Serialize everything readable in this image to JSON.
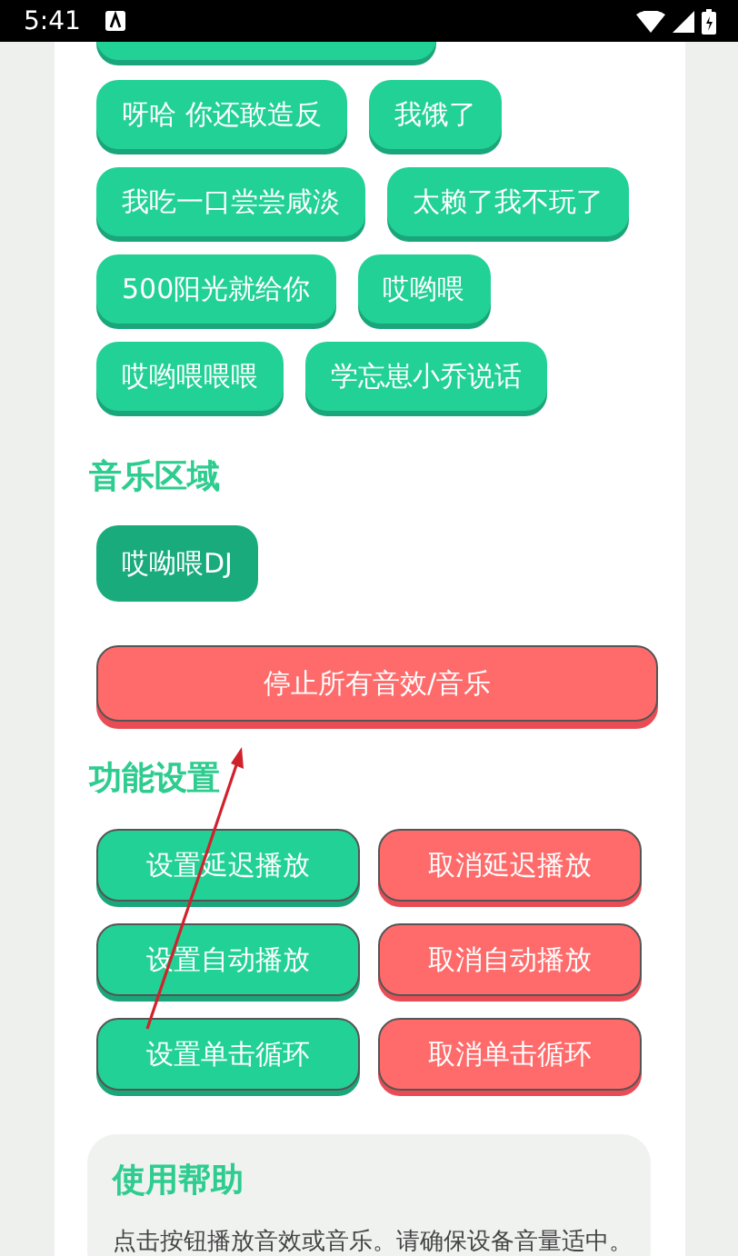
{
  "status_bar": {
    "time": "5:41"
  },
  "sound_buttons": [
    {
      "label": "呀哈 你还敢造反"
    },
    {
      "label": "我饿了"
    },
    {
      "label": "我吃一口尝尝咸淡"
    },
    {
      "label": "太赖了我不玩了"
    },
    {
      "label": "500阳光就给你"
    },
    {
      "label": "哎哟喂"
    },
    {
      "label": "哎哟喂喂喂"
    },
    {
      "label": "学忘崽小乔说话"
    }
  ],
  "music_section": {
    "title": "音乐区域",
    "buttons": [
      {
        "label": "哎呦喂DJ"
      }
    ]
  },
  "stop_button": {
    "label": "停止所有音效/音乐"
  },
  "settings_section": {
    "title": "功能设置",
    "buttons": [
      {
        "label": "设置延迟播放",
        "kind": "set"
      },
      {
        "label": "取消延迟播放",
        "kind": "cancel"
      },
      {
        "label": "设置自动播放",
        "kind": "set"
      },
      {
        "label": "取消自动播放",
        "kind": "cancel"
      },
      {
        "label": "设置单击循环",
        "kind": "set"
      },
      {
        "label": "取消单击循环",
        "kind": "cancel"
      }
    ]
  },
  "help": {
    "title": "使用帮助",
    "text": "点击按钮播放音效或音乐。请确保设备音量适中。"
  }
}
